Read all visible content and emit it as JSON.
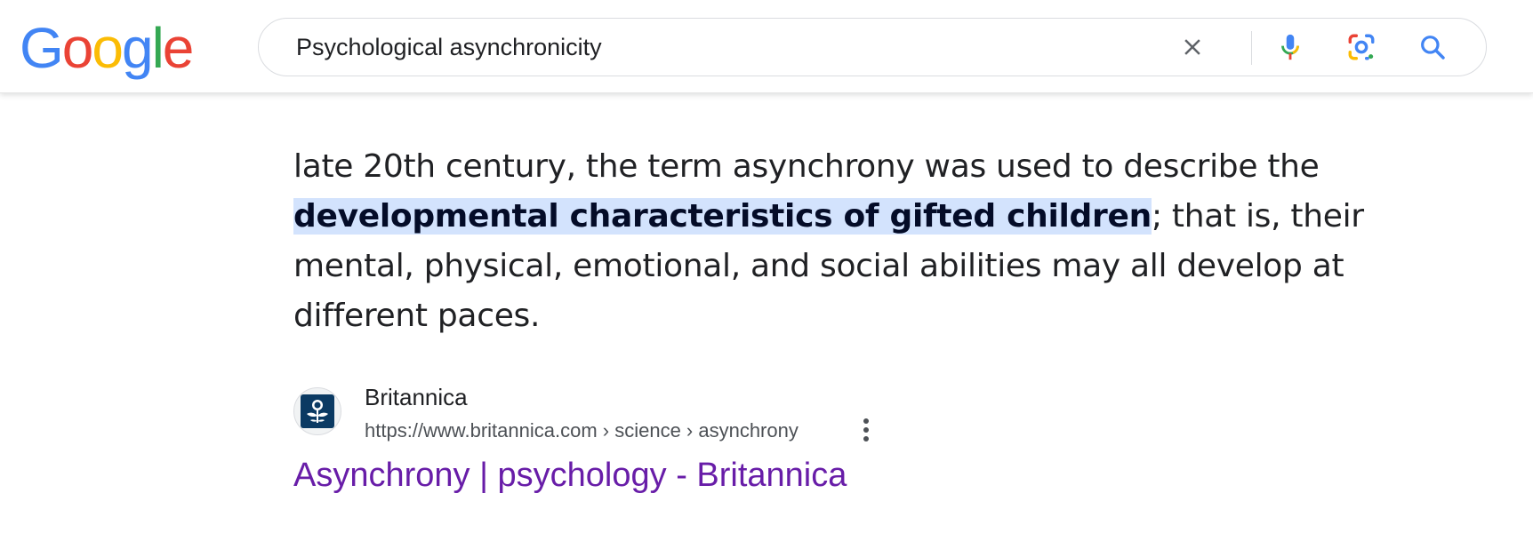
{
  "logo": {
    "letters": [
      "G",
      "o",
      "o",
      "g",
      "l",
      "e"
    ],
    "colors": [
      "#4285F4",
      "#EA4335",
      "#FBBC05",
      "#4285F4",
      "#34A853",
      "#EA4335"
    ]
  },
  "search": {
    "query": "Psychological asynchronicity",
    "icons": [
      "close-icon",
      "microphone-icon",
      "google-lens-icon",
      "search-icon"
    ]
  },
  "snippet": {
    "text_before": "late 20th century, the term asynchrony was used to describe the ",
    "highlight": "developmental characteristics of gifted children",
    "text_after": "; that is, their mental, physical, emotional, and social abilities may all develop at different paces."
  },
  "source": {
    "name": "Britannica",
    "url": "https://www.britannica.com › science › asynchrony",
    "favicon": "britannica-thistle-icon",
    "more_icon": "more-vert-icon"
  },
  "result": {
    "title": "Asynchrony | psychology - Britannica",
    "visited_color": "#681da8"
  },
  "colors": {
    "highlight_bg": "#d3e3fd",
    "search_blue": "#4285F4"
  }
}
